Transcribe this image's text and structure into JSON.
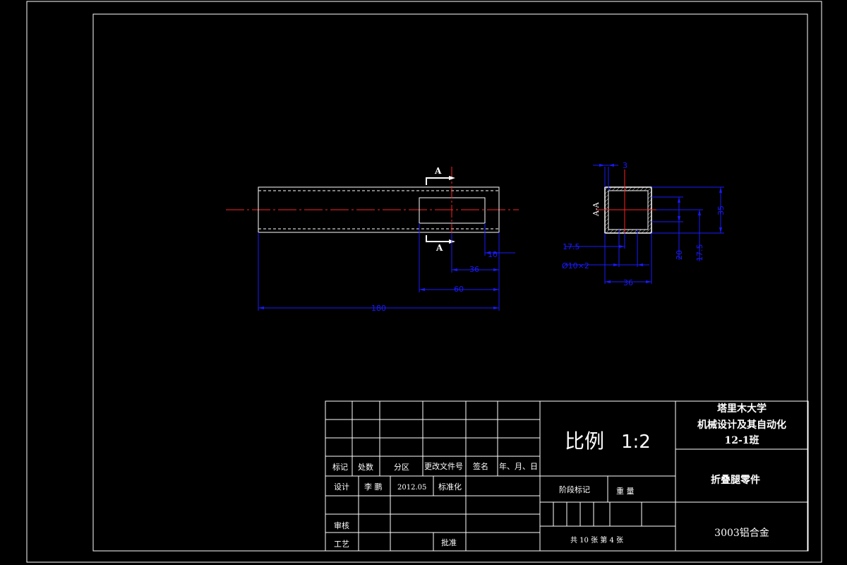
{
  "drawing": {
    "section_label_top": "A",
    "section_label_bottom": "A",
    "section_view_label": "A-A",
    "dims_front": {
      "d10": "10",
      "d36": "36",
      "d60": "60",
      "d180": "180"
    },
    "dims_section": {
      "d3": "3",
      "d35": "35",
      "d175_left": "17.5",
      "d20": "20",
      "d175_right": "17.5",
      "hole": "Ø10×2",
      "d36": "36"
    }
  },
  "title_block": {
    "university": "塔里木大学",
    "major": "机械设计及其自动化",
    "class": "12-1班",
    "scale_label": "比例",
    "scale_value": "1:2",
    "part_name": "折叠腿零件",
    "material": "3003铝合金",
    "headers": {
      "mark": "标记",
      "count": "处数",
      "zone": "分区",
      "change_doc": "更改文件号",
      "signature": "签名",
      "date": "年、月、日"
    },
    "design_label": "设计",
    "designer": "李 鹏",
    "design_date": "2012.05",
    "standardize": "标准化",
    "stage_mark": "阶段标记",
    "weight": "重 量",
    "review": "审核",
    "process": "工艺",
    "approve": "批准",
    "sheets": "共 10 张 第 4 张"
  }
}
